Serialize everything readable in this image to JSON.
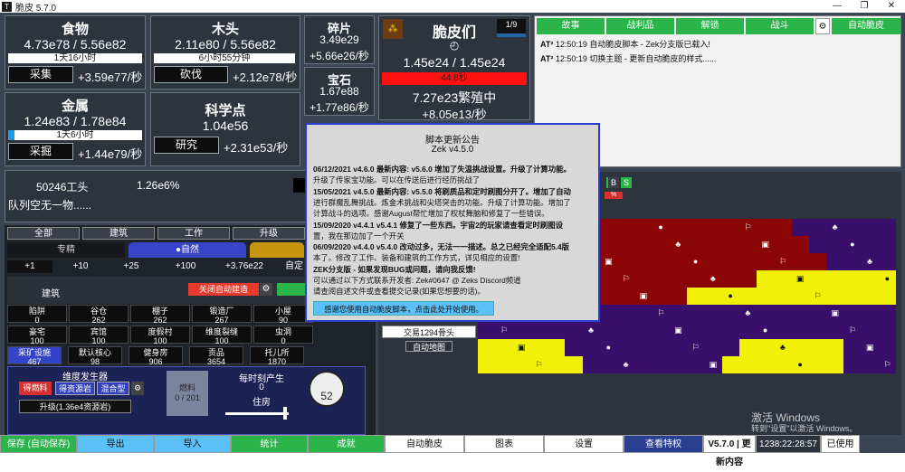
{
  "window": {
    "title": "脆皮 5.7.0",
    "icon": "T"
  },
  "resources": {
    "food": {
      "name": "食物",
      "value": "4.73e78 / 5.56e82",
      "bar": "1天16小时",
      "action": "采集",
      "rate": "+3.59e77/秒"
    },
    "wood": {
      "name": "木头",
      "value": "2.11e80 / 5.56e82",
      "bar": "6小时55分钟",
      "action": "砍伐",
      "rate": "+2.12e78/秒"
    },
    "metal": {
      "name": "金属",
      "value": "1.24e83 / 1.78e84",
      "bar": "1天6小时",
      "action": "采掘",
      "rate": "+1.44e79/秒"
    },
    "science": {
      "name": "科学点",
      "value": "1.04e56",
      "action": "研究",
      "rate": "+2.31e53/秒"
    },
    "fragments": {
      "name": "碎片",
      "value": "3.49e29",
      "rate": "+5.66e26/秒"
    },
    "gems": {
      "name": "宝石",
      "value": "1.67e88",
      "rate": "+1.77e86/秒"
    },
    "trimps": {
      "name": "脆皮们",
      "value": "1.45e24 / 1.45e24",
      "bar": "44.8秒",
      "breeding": "7.27e23繁殖中",
      "rate": "+8.05e13/秒",
      "badge": "1/9"
    }
  },
  "workers": {
    "count": "50246工头",
    "percent": "1.26e6%",
    "queue": "队列空无一物......"
  },
  "buy_tabs": [
    "全部",
    "建筑",
    "工作",
    "升级"
  ],
  "sub_tabs": [
    "专精",
    "●自然"
  ],
  "amounts": [
    "+1",
    "+10",
    "+25",
    "+100",
    "+3.76e22",
    "自定"
  ],
  "buildings_header": {
    "title": "建筑",
    "auto_label": "关闭自动建造"
  },
  "buildings": [
    {
      "name": "陷阱",
      "count": "0"
    },
    {
      "name": "谷仓",
      "count": "262"
    },
    {
      "name": "棚子",
      "count": "262"
    },
    {
      "name": "锻造厂",
      "count": "267"
    },
    {
      "name": "小屋",
      "count": "90"
    },
    {
      "name": "豪宅",
      "count": "100"
    },
    {
      "name": "宾馆",
      "count": "100"
    },
    {
      "name": "度假村",
      "count": "100"
    },
    {
      "name": "维度裂缝",
      "count": "100"
    },
    {
      "name": "虫洞",
      "count": "0"
    },
    {
      "name": "采矿设施",
      "count": "467"
    },
    {
      "name": "默认核心",
      "count": "98"
    },
    {
      "name": "健身房",
      "count": "906"
    },
    {
      "name": "贡品",
      "count": "3654"
    },
    {
      "name": "托儿所",
      "count": "1870"
    }
  ],
  "generator": {
    "title": "维度发生器",
    "btn1": "得燃料",
    "btn2": "得资源岩",
    "btn3": "混合型",
    "upgrade": "升级(1.36e4资源岩)",
    "fuel_label": "燃料",
    "fuel_value": "0 / 201",
    "produce_label": "每时刻产生",
    "produce_value": "0",
    "house_label": "住房",
    "dial": "52"
  },
  "log": {
    "tabs": [
      "故事",
      "战利品",
      "解锁",
      "战斗"
    ],
    "auto_label": "自动脆皮",
    "lines": [
      "12:50:19 自动脆皮脚本 - Zek分支版已载入!",
      "12:50:19 切换主题 - 更新自动脆皮的样式......"
    ],
    "prefix": "AT²"
  },
  "map": {
    "trade": "交易1294骨头",
    "auto": "自动地图",
    "letters": [
      "A",
      "B",
      "S"
    ],
    "colors": {
      "yellow": "#f0f008",
      "red": "#8b0707",
      "purple": "#3a0f6b"
    }
  },
  "modal": {
    "title": "脚本更新公告",
    "version": "Zek v4.5.0",
    "lines": [
      "06/12/2021 v4.6.0 最新内容: v5.6.0 增加了失温挑战设置。升级了计算功能。",
      "升级了传家宝功能。可以在传送后进行经历挑战了",
      "15/05/2021 v4.5.0 最新内容: v5.5.0 将刷质品和定时刷图分开了。增加了自动",
      "进行群魔乱舞挑战。炼金术挑战和尖塔突击的功能。升级了计算功能。增加了",
      "计算战斗的选项。感谢August帮忙增加了权杖舞脑和修复了一些错误。",
      "15/09/2020 v4.4.1 v5.4.1 修复了一些东西。宇宙2的玩家请查看定时刷图设",
      "置，我在那边加了一个开关",
      "06/09/2020 v4.4.0 v5.4.0 改动过多，无法一一描述。总之已经完全适配5.4版",
      "本了。修改了工作、装备和建筑的工作方式，详见相应的设置!",
      "ZEK分支版 - 如果发现BUG或问题，请向我反馈!",
      "可以通过以下方式联系开发者: Zek#0647 @ Zeks Discord频道",
      "请查阅自述文件或查看提交记录(如果您想要的话)。"
    ],
    "confirm": "感谢您使用自动脆皮脚本，点击此处开始使用。"
  },
  "watermark": {
    "line1": "激活 Windows",
    "line2": "转到\"设置\"以激活 Windows。"
  },
  "bottom": [
    {
      "label": "保存 (自动保存)"
    },
    {
      "label": "导出"
    },
    {
      "label": "导入"
    },
    {
      "label": "统计"
    },
    {
      "label": "成就"
    },
    {
      "label": "自动脆皮"
    },
    {
      "label": "图表"
    },
    {
      "label": "设置"
    },
    {
      "label": "查看特权"
    },
    {
      "label": "V5.7.0 | 更新内容"
    },
    {
      "label": "1238:22:28:57"
    },
    {
      "label": "已使用"
    }
  ]
}
